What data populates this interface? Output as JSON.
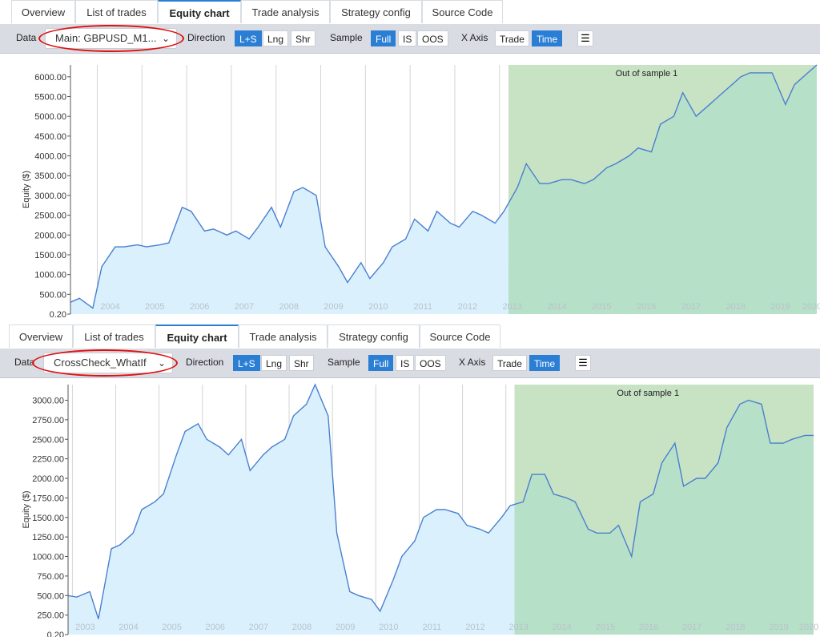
{
  "tabs": [
    "Overview",
    "List of trades",
    "Equity chart",
    "Trade analysis",
    "Strategy config",
    "Source Code"
  ],
  "active_tab": "Equity chart",
  "toolbar": {
    "data_label": "Data",
    "direction_label": "Direction",
    "direction_options": [
      "L+S",
      "Lng",
      "Shr"
    ],
    "direction_selected": "L+S",
    "sample_label": "Sample",
    "sample_options": [
      "Full",
      "IS",
      "OOS"
    ],
    "sample_selected": "Full",
    "xaxis_label": "X Axis",
    "xaxis_options": [
      "Trade",
      "Time"
    ],
    "xaxis_selected": "Time",
    "menu_icon": "hamburger-menu-icon"
  },
  "panels": [
    {
      "data_value": "Main: GBPUSD_M1..."
    },
    {
      "data_value": "CrossCheck_WhatIf"
    }
  ],
  "colors": {
    "line": "#4a7fd0",
    "fill_is": "#daf1fd",
    "oos_band": "#c7e3c4",
    "oos_fill": "#b7e0c8",
    "highlight_oval": "#e01010",
    "active_button": "#2a7fd4"
  },
  "chart_data": [
    {
      "type": "area",
      "ylabel": "Equity ($)",
      "yticks": [
        "0.20",
        "500.00",
        "1000.00",
        "1500.00",
        "2000.00",
        "2500.00",
        "3000.00",
        "3500.00",
        "4000.00",
        "4500.00",
        "5000.00",
        "5500.00",
        "6000.00"
      ],
      "ylim": [
        0.2,
        6300
      ],
      "xlabels": [
        "2004",
        "2005",
        "2006",
        "2007",
        "2008",
        "2009",
        "2010",
        "2011",
        "2012",
        "2013",
        "2014",
        "2015",
        "2016",
        "2017",
        "2018",
        "2019",
        "2020"
      ],
      "xlim": [
        2003.4,
        2020.1
      ],
      "oos_start": 2013.2,
      "oos_label": "Out of sample 1",
      "x": [
        2003.4,
        2003.6,
        2003.9,
        2004.1,
        2004.4,
        2004.6,
        2004.9,
        2005.1,
        2005.4,
        2005.6,
        2005.9,
        2006.1,
        2006.4,
        2006.6,
        2006.9,
        2007.1,
        2007.4,
        2007.6,
        2007.9,
        2008.1,
        2008.4,
        2008.6,
        2008.9,
        2009.1,
        2009.4,
        2009.6,
        2009.9,
        2010.1,
        2010.4,
        2010.6,
        2010.9,
        2011.1,
        2011.4,
        2011.6,
        2011.9,
        2012.1,
        2012.4,
        2012.6,
        2012.9,
        2013.1,
        2013.4,
        2013.6,
        2013.9,
        2014.1,
        2014.4,
        2014.6,
        2014.9,
        2015.1,
        2015.4,
        2015.6,
        2015.9,
        2016.1,
        2016.4,
        2016.6,
        2016.9,
        2017.1,
        2017.4,
        2017.6,
        2017.9,
        2018.1,
        2018.4,
        2018.6,
        2018.9,
        2019.1,
        2019.4,
        2019.6,
        2019.9,
        2020.1
      ],
      "y": [
        300,
        400,
        150,
        1200,
        1700,
        1700,
        1750,
        1700,
        1750,
        1800,
        2700,
        2600,
        2100,
        2150,
        2000,
        2100,
        1900,
        2200,
        2700,
        2200,
        3100,
        3200,
        3000,
        1700,
        1200,
        800,
        1300,
        900,
        1300,
        1700,
        1900,
        2400,
        2100,
        2600,
        2300,
        2200,
        2600,
        2500,
        2300,
        2600,
        3200,
        3800,
        3300,
        3300,
        3400,
        3400,
        3300,
        3400,
        3700,
        3800,
        4000,
        4200,
        4100,
        4800,
        5000,
        5600,
        5000,
        5200,
        5500,
        5700,
        6000,
        6100,
        6100,
        6100,
        5300,
        5800,
        6100,
        6300
      ]
    },
    {
      "type": "area",
      "ylabel": "Equity ($)",
      "yticks": [
        "0.20",
        "250.00",
        "500.00",
        "750.00",
        "1000.00",
        "1250.00",
        "1500.00",
        "1750.00",
        "2000.00",
        "2250.00",
        "2500.00",
        "2750.00",
        "3000.00"
      ],
      "ylim": [
        0.2,
        3200
      ],
      "xlabels": [
        "2003",
        "2004",
        "2005",
        "2006",
        "2007",
        "2008",
        "2009",
        "2010",
        "2011",
        "2012",
        "2013",
        "2014",
        "2015",
        "2016",
        "2017",
        "2018",
        "2019",
        "2020"
      ],
      "xlim": [
        2002.9,
        2020.1
      ],
      "oos_start": 2013.2,
      "oos_label": "Out of sample 1",
      "x": [
        2002.9,
        2003.1,
        2003.4,
        2003.6,
        2003.9,
        2004.1,
        2004.4,
        2004.6,
        2004.9,
        2005.1,
        2005.4,
        2005.6,
        2005.9,
        2006.1,
        2006.4,
        2006.6,
        2006.9,
        2007.1,
        2007.4,
        2007.6,
        2007.9,
        2008.1,
        2008.4,
        2008.6,
        2008.9,
        2009.1,
        2009.4,
        2009.6,
        2009.9,
        2010.1,
        2010.4,
        2010.6,
        2010.9,
        2011.1,
        2011.4,
        2011.6,
        2011.9,
        2012.1,
        2012.4,
        2012.6,
        2012.9,
        2013.1,
        2013.4,
        2013.6,
        2013.9,
        2014.1,
        2014.4,
        2014.6,
        2014.9,
        2015.1,
        2015.4,
        2015.6,
        2015.9,
        2016.1,
        2016.4,
        2016.6,
        2016.9,
        2017.1,
        2017.4,
        2017.6,
        2017.9,
        2018.1,
        2018.4,
        2018.6,
        2018.9,
        2019.1,
        2019.4,
        2019.6,
        2019.9,
        2020.1
      ],
      "y": [
        500,
        480,
        550,
        200,
        1100,
        1150,
        1300,
        1600,
        1700,
        1800,
        2300,
        2600,
        2700,
        2500,
        2400,
        2300,
        2500,
        2100,
        2300,
        2400,
        2500,
        2800,
        2950,
        3200,
        2800,
        1300,
        550,
        500,
        450,
        300,
        700,
        1000,
        1200,
        1500,
        1600,
        1600,
        1550,
        1400,
        1350,
        1300,
        1500,
        1650,
        1700,
        2050,
        2050,
        1800,
        1750,
        1700,
        1350,
        1300,
        1300,
        1400,
        1000,
        1700,
        1800,
        2200,
        2450,
        1900,
        2000,
        2000,
        2200,
        2650,
        2950,
        3000,
        2950,
        2450,
        2450,
        2500,
        2550,
        2550
      ]
    }
  ]
}
